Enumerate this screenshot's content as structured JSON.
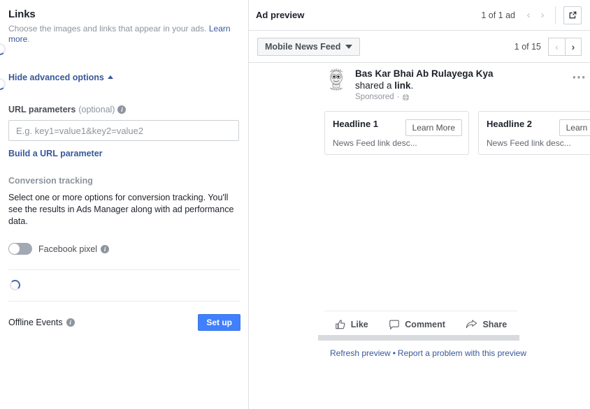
{
  "left_panel": {
    "section_title": "Links",
    "section_subtitle": "Choose the images and links that appear in your ads.",
    "learn_more": "Learn more",
    "period": ".",
    "hide_advanced": "Hide advanced options",
    "url_params_label": "URL parameters",
    "url_params_optional": "(optional)",
    "url_params_value": "",
    "url_params_placeholder": "E.g. key1=value1&key2=value2",
    "build_url_parameter": "Build a URL parameter",
    "conversion_tracking_header": "Conversion tracking",
    "conversion_tracking_desc": "Select one or more options for conversion tracking. You'll see the results in Ads Manager along with ad performance data.",
    "facebook_pixel_label": "Facebook pixel",
    "facebook_pixel_state": "off",
    "offline_events_label": "Offline Events",
    "setup_button": "Set up"
  },
  "right_panel": {
    "header_title": "Ad preview",
    "ad_count": "1 of 1 ad",
    "placement_selector": "Mobile News Feed",
    "preview_count": "1 of 15",
    "ad": {
      "page_name": "Bas Kar Bhai Ab Rulayega Kya",
      "shared_text_prefix": "shared a ",
      "shared_text_bold": "link",
      "shared_text_suffix": ".",
      "sponsored": "Sponsored",
      "cards": [
        {
          "headline": "Headline 1",
          "description": "News Feed link desc...",
          "cta": "Learn More"
        },
        {
          "headline": "Headline 2",
          "description": "News Feed link desc...",
          "cta": "Learn More"
        }
      ],
      "actions": [
        {
          "label": "Like",
          "icon": "thumbs-up-icon"
        },
        {
          "label": "Comment",
          "icon": "comment-bubble-icon"
        },
        {
          "label": "Share",
          "icon": "share-arrow-icon"
        }
      ]
    },
    "footer": {
      "refresh": "Refresh preview",
      "separator": "•",
      "report": "Report a problem with this preview"
    }
  },
  "colors": {
    "link_blue": "#385898",
    "brand_blue": "#4080ff",
    "border": "#dddfe2",
    "muted_text": "#8d949e"
  }
}
